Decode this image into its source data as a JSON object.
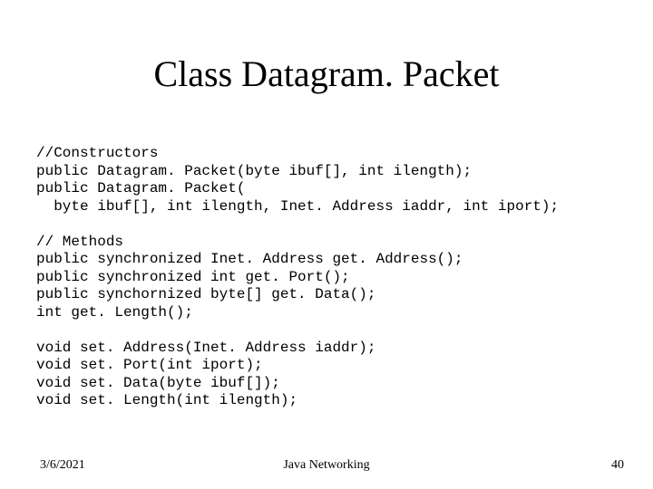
{
  "title": "Class Datagram. Packet",
  "code": "//Constructors\npublic Datagram. Packet(byte ibuf[], int ilength);\npublic Datagram. Packet(\n  byte ibuf[], int ilength, Inet. Address iaddr, int iport);\n\n// Methods\npublic synchronized Inet. Address get. Address();\npublic synchronized int get. Port();\npublic synchornized byte[] get. Data();\nint get. Length();\n\nvoid set. Address(Inet. Address iaddr);\nvoid set. Port(int iport);\nvoid set. Data(byte ibuf[]);\nvoid set. Length(int ilength);",
  "footer": {
    "date": "3/6/2021",
    "subject": "Java Networking",
    "page": "40"
  }
}
